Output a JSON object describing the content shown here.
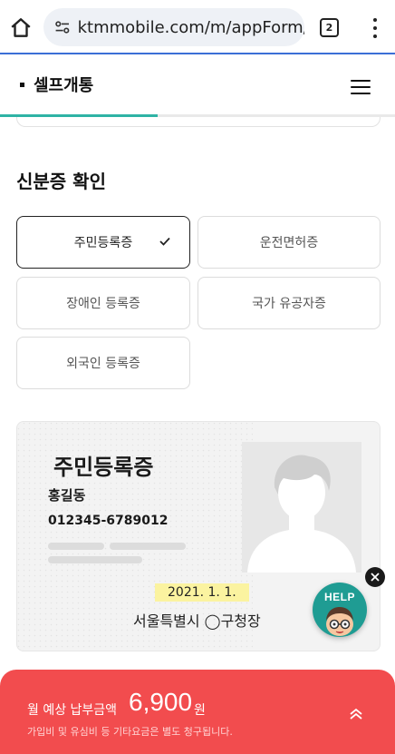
{
  "browser": {
    "url": "ktmmobile.com/m/appForm/",
    "tab_count": "2"
  },
  "header": {
    "title": "셀프개통",
    "progress": 0.4
  },
  "section": {
    "title": "신분증 확인"
  },
  "id_options": [
    {
      "label": "주민등록증",
      "selected": true
    },
    {
      "label": "운전면허증",
      "selected": false
    },
    {
      "label": "장애인 등록증",
      "selected": false
    },
    {
      "label": "국가 유공자증",
      "selected": false
    },
    {
      "label": "외국인 등록증",
      "selected": false
    }
  ],
  "id_card": {
    "title": "주민등록증",
    "name": "홍길동",
    "number": "012345-6789012",
    "date": "2021. 1. 1.",
    "issuer": "서울특별시 ◯구청장"
  },
  "help": {
    "label": "HELP"
  },
  "payment": {
    "label": "월 예상 납부금액",
    "amount": "6,900",
    "unit": "원",
    "note": "가입비 및 유심비 등 기타요금은 별도 청구됩니다."
  },
  "colors": {
    "accent": "#2fb3a5",
    "pay_bar": "#f24c4e",
    "help": "#1f9c93",
    "browser_line": "#3b6fd6"
  }
}
